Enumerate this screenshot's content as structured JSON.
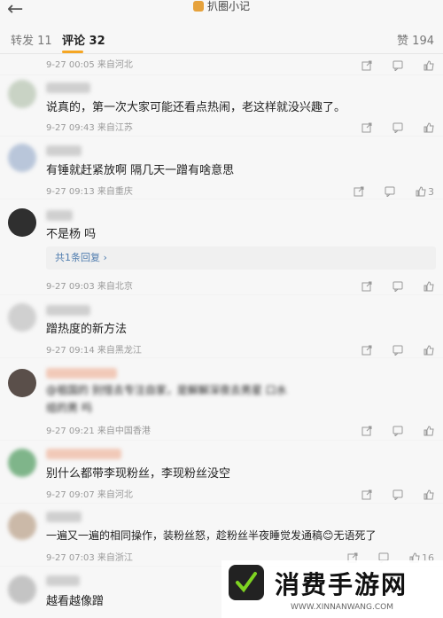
{
  "header": {
    "title": "扒圈小记"
  },
  "tabs": {
    "repost": "转发 11",
    "comments": "评论 32",
    "likes": "赞 194"
  },
  "first_meta": "9-27 00:05  来自河北",
  "comments": [
    {
      "text": "说真的，第一次大家可能还看点热闹，老这样就没兴趣了。",
      "meta": "9-27 09:43  来自江苏",
      "likes": ""
    },
    {
      "text": "有锤就赶紧放啊   隔几天一蹭有啥意思",
      "meta": "9-27 09:13  来自重庆",
      "likes": "3"
    },
    {
      "text": "不是杨  吗",
      "meta": "9-27 09:03  来自北京",
      "likes": "",
      "reply": "共1条回复 ›"
    },
    {
      "text": "蹭热度的新方法",
      "meta": "9-27 09:14  来自黑龙江",
      "likes": ""
    },
    {
      "text": "@祖国的  别怪去专注自家，是解解深夜去男星  口水",
      "text2": "组的男  吗",
      "meta": "9-27 09:21  来自中国香港",
      "likes": ""
    },
    {
      "text": "别什么都带李现粉丝，李现粉丝没空",
      "meta": "9-27 09:07  来自河北",
      "likes": ""
    },
    {
      "text": "一遍又一遍的相同操作，装粉丝怒，趁粉丝半夜睡觉发通稿😊无语死了",
      "meta": "9-27 07:03  来自浙江",
      "likes": "16"
    },
    {
      "text": "越看越像蹭",
      "meta": "",
      "likes": ""
    }
  ],
  "watermark": {
    "title": "消费手游网",
    "url": "WWW.XINNANWANG.COM"
  },
  "colors": {
    "accent": "#f5a623",
    "link": "#507daf"
  }
}
